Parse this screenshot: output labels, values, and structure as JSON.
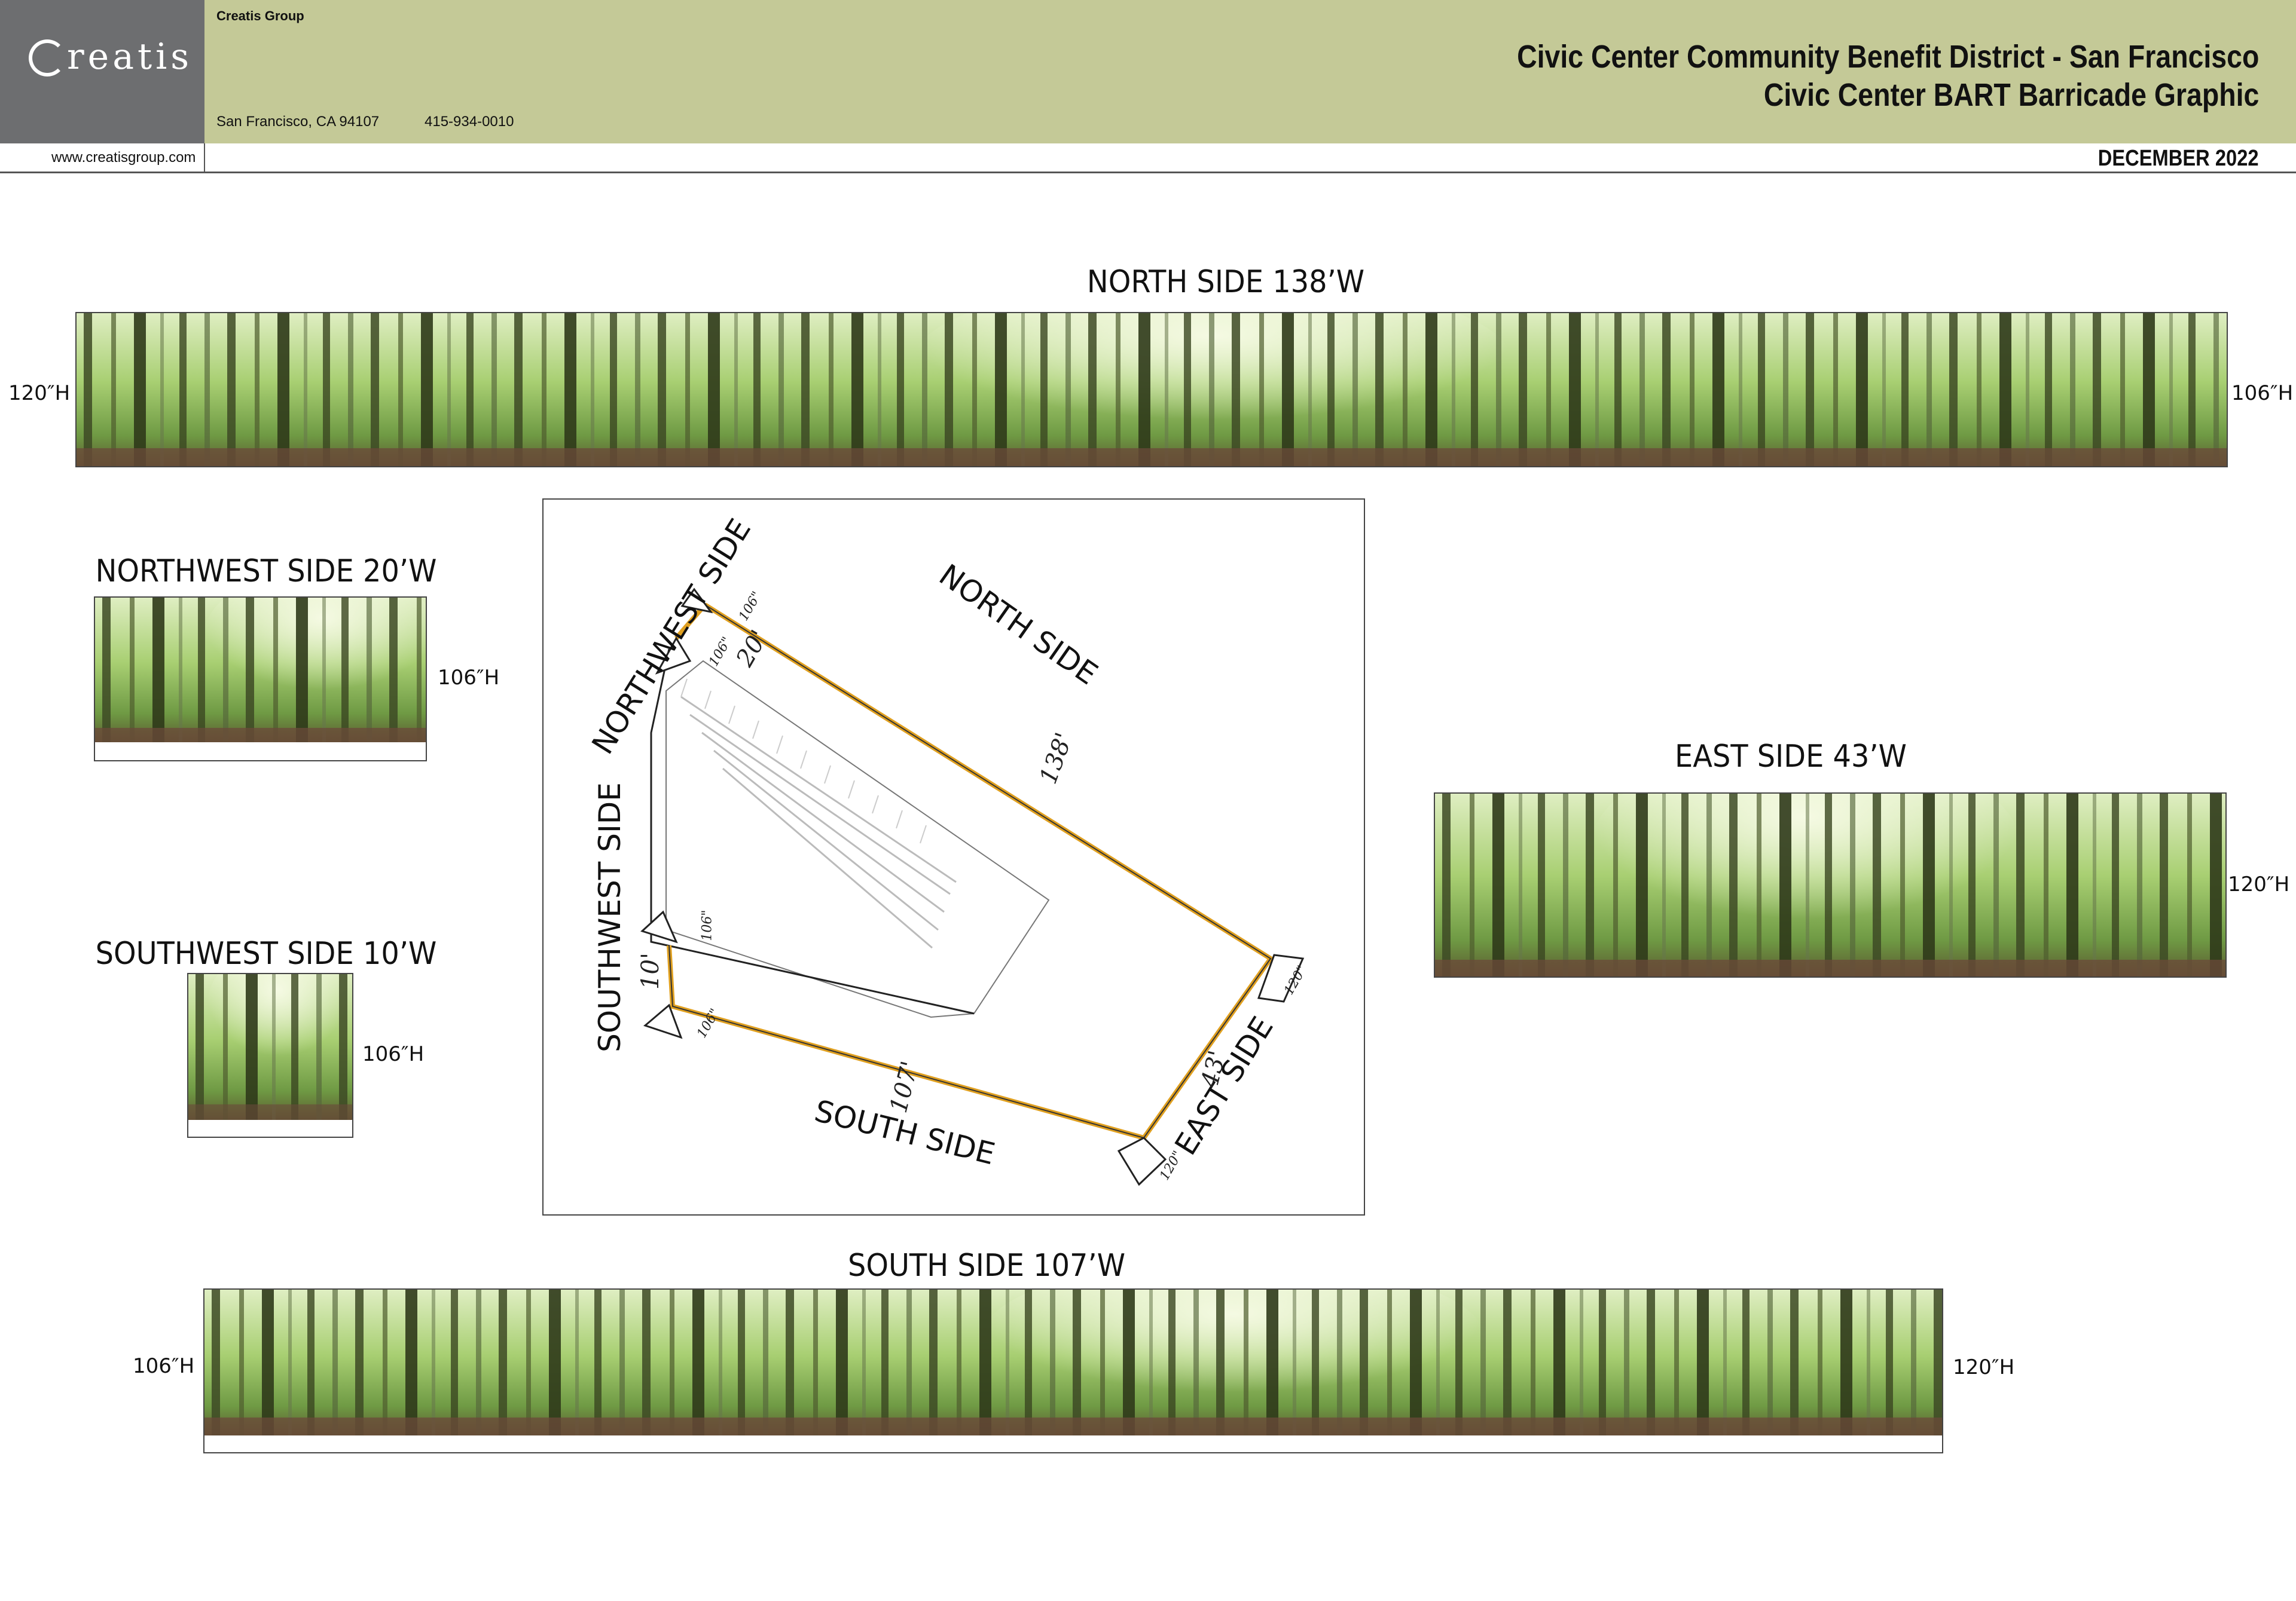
{
  "header": {
    "company_name": "Creatis Group",
    "logo_text": "reatis",
    "address": "San Francisco, CA 94107",
    "phone": "415-934-0010",
    "website": "www.creatisgroup.com",
    "title_line1": "Civic Center Community Benefit District - San Francisco",
    "title_line2": "Civic Center BART Barricade Graphic",
    "date": "DECEMBER 2022",
    "band_color": "#c4c997",
    "logo_bg_color": "#6d6e70"
  },
  "panels": {
    "north": {
      "label": "NORTH SIDE  138’W",
      "left_height": "120″H",
      "right_height": "106″H"
    },
    "northwest": {
      "label": "NORTHWEST SIDE 20’W",
      "right_height": "106″H"
    },
    "southwest": {
      "label": "SOUTHWEST SIDE 10’W",
      "right_height": "106″H"
    },
    "east": {
      "label": "EAST SIDE  43’W",
      "right_height": "120″H"
    },
    "south": {
      "label": "SOUTH SIDE  107’W",
      "left_height": "106″H",
      "right_height": "120″H"
    }
  },
  "site_plan": {
    "labels": {
      "north": "NORTH SIDE",
      "northwest": "NORTHWEST SIDE",
      "southwest": "SOUTHWEST SIDE",
      "south": "SOUTH SIDE",
      "east": "EAST SIDE"
    },
    "handwritten": {
      "north_length": "138'",
      "northwest_length": "20'",
      "southwest_length": "10'",
      "south_length": "107'",
      "east_length": "43'",
      "corner_106a": "106\"",
      "corner_106b": "106\"",
      "corner_106c": "106\"",
      "corner_106d": "106\"",
      "corner_120a": "120\"",
      "corner_120b": "120\""
    },
    "outline_color": "#e0a020"
  },
  "icons": {
    "logo": "creatis-logo-icon",
    "forest": "forest-photo-icon"
  }
}
